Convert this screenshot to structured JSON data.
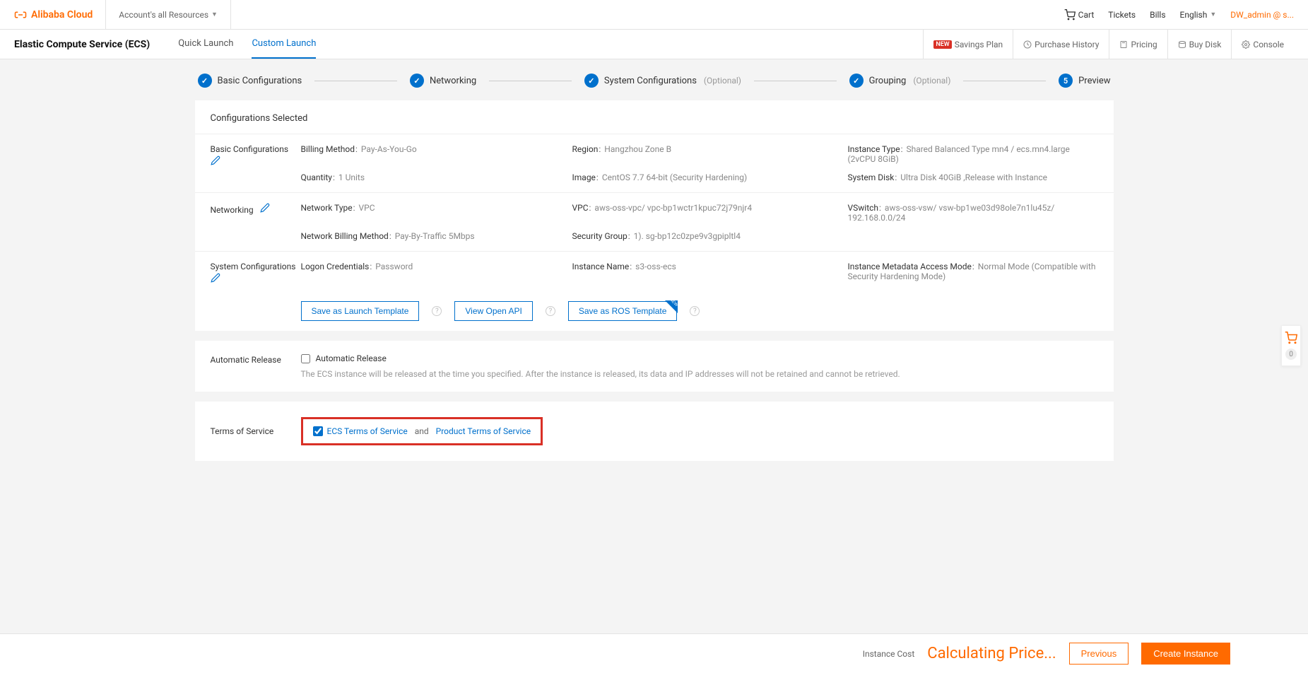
{
  "header": {
    "brand": "Alibaba Cloud",
    "account_selector": "Account's all Resources",
    "cart": "Cart",
    "tickets": "Tickets",
    "bills": "Bills",
    "language": "English",
    "user": "DW_admin @ s..."
  },
  "subheader": {
    "title": "Elastic Compute Service (ECS)",
    "tabs": {
      "quick": "Quick Launch",
      "custom": "Custom Launch"
    },
    "actions": {
      "savings_plan": "Savings Plan",
      "new_badge": "NEW",
      "purchase_history": "Purchase History",
      "pricing": "Pricing",
      "buy_disk": "Buy Disk",
      "console": "Console"
    }
  },
  "stepper": {
    "s1": "Basic Configurations",
    "s2": "Networking",
    "s3": "System Configurations",
    "s4": "Grouping",
    "s5_num": "5",
    "s5": "Preview",
    "optional": "(Optional)"
  },
  "review": {
    "heading": "Configurations Selected",
    "basic": {
      "label": "Basic Configurations",
      "billing_k": "Billing Method",
      "billing_v": "Pay-As-You-Go",
      "region_k": "Region",
      "region_v": "Hangzhou Zone B",
      "instance_type_k": "Instance Type",
      "instance_type_v": "Shared Balanced Type mn4 / ecs.mn4.large  (2vCPU 8GiB)",
      "quantity_k": "Quantity",
      "quantity_v": "1 Units",
      "image_k": "Image",
      "image_v": "CentOS 7.7 64-bit  (Security Hardening)",
      "system_disk_k": "System Disk",
      "system_disk_v": "Ultra Disk 40GiB ,Release with Instance"
    },
    "networking": {
      "label": "Networking",
      "network_type_k": "Network Type",
      "network_type_v": "VPC",
      "vpc_k": "VPC",
      "vpc_v": "aws-oss-vpc/ vpc-bp1wctr1kpuc72j79njr4",
      "vswitch_k": "VSwitch",
      "vswitch_v": "aws-oss-vsw/ vsw-bp1we03d98ole7n1lu45z/ 192.168.0.0/24",
      "billing_k": "Network Billing Method",
      "billing_v": "Pay-By-Traffic 5Mbps",
      "sg_k": "Security Group",
      "sg_v": "1). sg-bp12c0zpe9v3gpipltl4"
    },
    "system": {
      "label": "System Configurations",
      "logon_k": "Logon Credentials",
      "logon_v": "Password",
      "instance_name_k": "Instance Name",
      "instance_name_v": "s3-oss-ecs",
      "metadata_k": "Instance Metadata Access Mode",
      "metadata_v": "Normal Mode (Compatible with Security Hardening Mode)"
    },
    "buttons": {
      "save_launch": "Save as Launch Template",
      "view_api": "View Open API",
      "save_ros": "Save as ROS Template"
    }
  },
  "auto_release": {
    "label": "Automatic Release",
    "checkbox": "Automatic Release",
    "note": "The ECS instance will be released at the time you specified. After the instance is released, its data and IP addresses will not be retained and cannot be retrieved."
  },
  "tos": {
    "label": "Terms of Service",
    "ecs": "ECS Terms of Service",
    "and": "and",
    "product": "Product Terms of Service"
  },
  "side_cart": {
    "count": "0"
  },
  "footer": {
    "cost_label": "Instance Cost",
    "cost_value": "Calculating Price...",
    "previous": "Previous",
    "create": "Create Instance"
  }
}
